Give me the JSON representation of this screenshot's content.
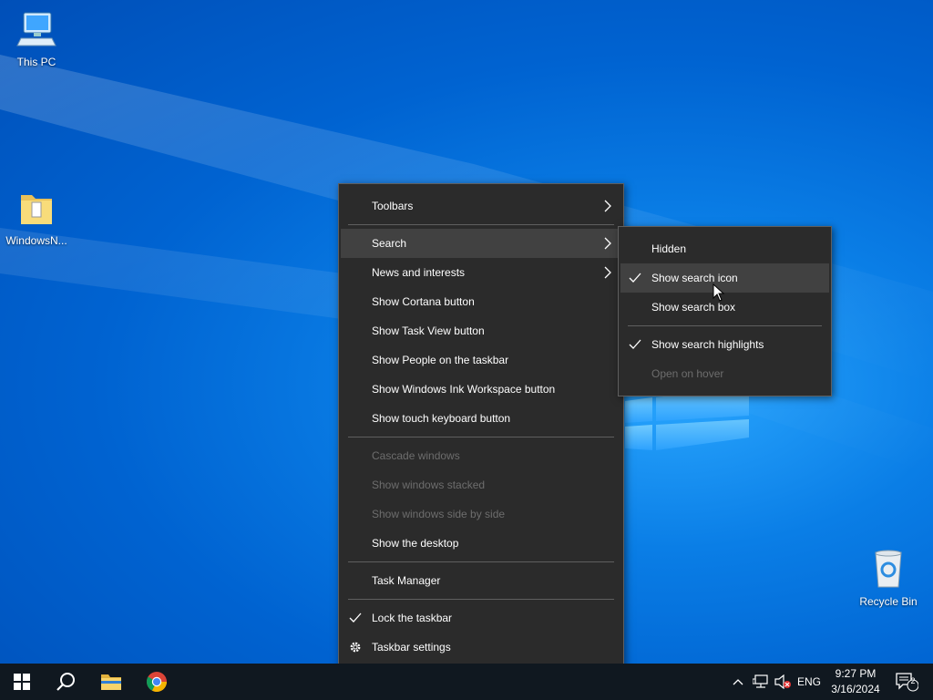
{
  "desktop": {
    "icons": [
      {
        "label": "This PC",
        "icon": "computer-icon"
      },
      {
        "label": "WindowsN...",
        "icon": "folder-icon"
      },
      {
        "label": "Recycle Bin",
        "icon": "recycle-bin-icon"
      }
    ]
  },
  "taskbar_menu": {
    "items": [
      {
        "label": "Toolbars",
        "submenu": true
      },
      {
        "label": "Search",
        "submenu": true,
        "highlighted": true
      },
      {
        "label": "News and interests",
        "submenu": true
      },
      {
        "label": "Show Cortana button"
      },
      {
        "label": "Show Task View button"
      },
      {
        "label": "Show People on the taskbar"
      },
      {
        "label": "Show Windows Ink Workspace button"
      },
      {
        "label": "Show touch keyboard button"
      },
      {
        "label": "Cascade windows",
        "disabled": true
      },
      {
        "label": "Show windows stacked",
        "disabled": true
      },
      {
        "label": "Show windows side by side",
        "disabled": true
      },
      {
        "label": "Show the desktop"
      },
      {
        "label": "Task Manager"
      },
      {
        "label": "Lock the taskbar",
        "checked": true
      },
      {
        "label": "Taskbar settings",
        "icon": "gear-icon"
      }
    ]
  },
  "search_submenu": {
    "items": [
      {
        "label": "Hidden"
      },
      {
        "label": "Show search icon",
        "checked": true,
        "highlighted": true
      },
      {
        "label": "Show search box"
      },
      {
        "label": "Show search highlights",
        "checked": true
      },
      {
        "label": "Open on hover",
        "disabled": true
      }
    ]
  },
  "taskbar": {
    "pinned": [
      "start-icon",
      "search-icon",
      "file-explorer-icon",
      "chrome-icon"
    ],
    "tray": {
      "language": "ENG",
      "time": "9:27 PM",
      "date": "3/16/2024",
      "notification_count": "2"
    }
  },
  "colors": {
    "menu_bg": "#2b2b2b",
    "menu_highlight": "#414141",
    "taskbar_bg": "#101820",
    "desktop_blue": "#0063d1"
  }
}
